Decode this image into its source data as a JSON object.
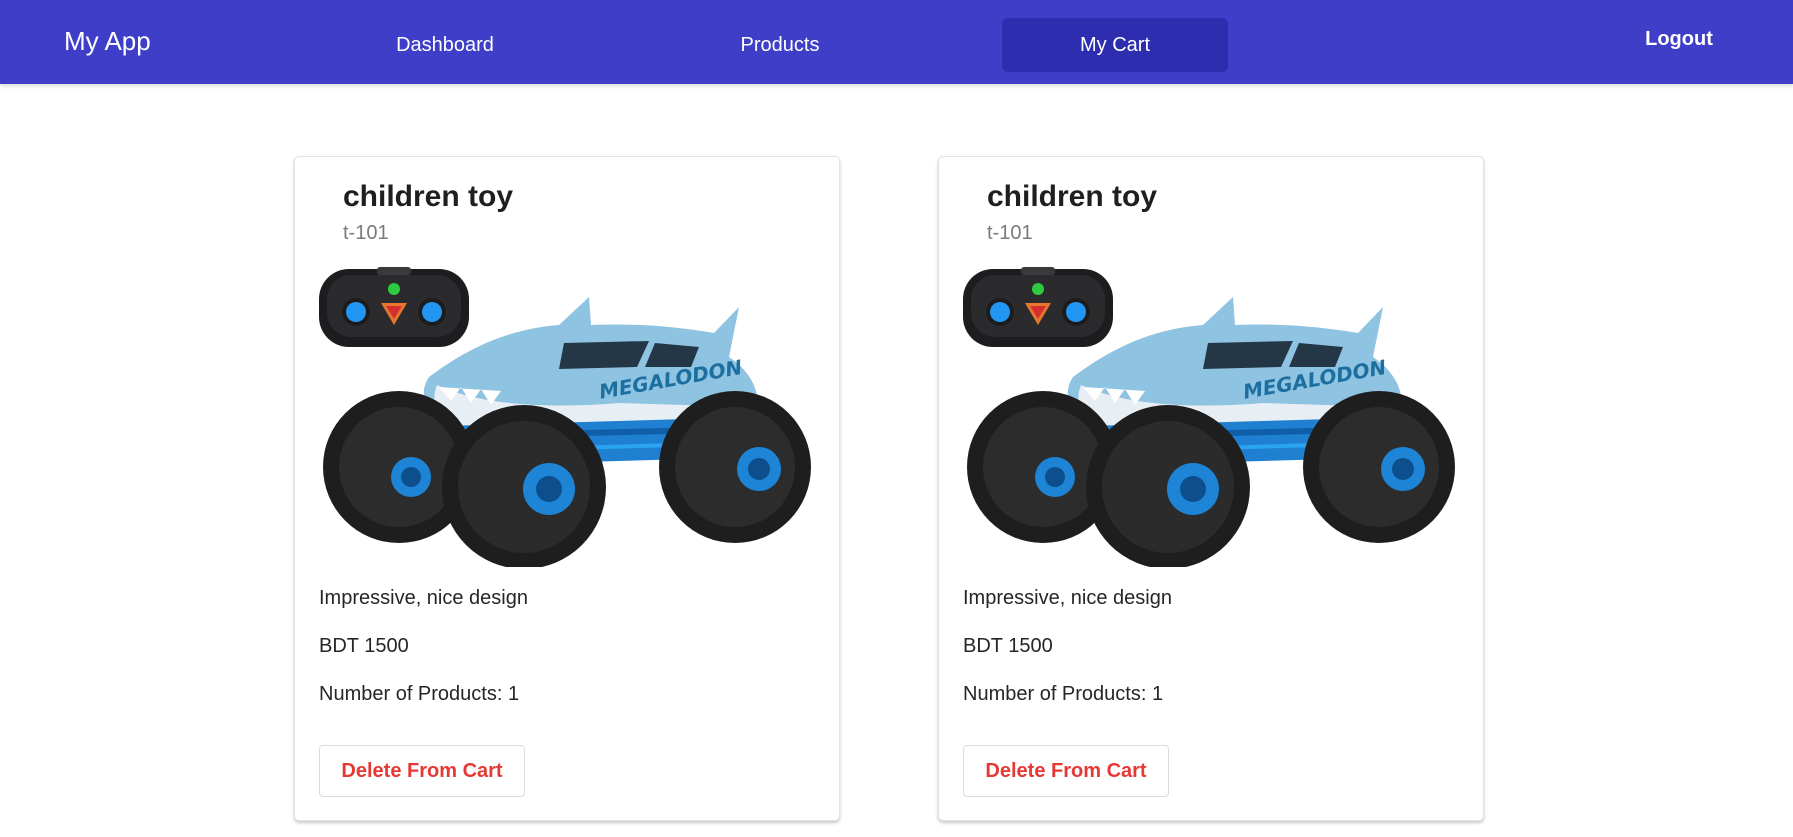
{
  "app": {
    "title": "My App"
  },
  "nav": {
    "dashboard": "Dashboard",
    "products": "Products",
    "cart": "My Cart",
    "logout": "Logout",
    "active": "My Cart"
  },
  "colors": {
    "navbar": "#3e3ec8",
    "nav_active": "#2d2daf",
    "delete_text": "#e53935"
  },
  "cart_items": [
    {
      "title": "children toy",
      "code": "t-101",
      "image": "monster-truck-toy-image",
      "description": "Impressive, nice design",
      "price": "BDT 1500",
      "quantity": "Number of Products: 1",
      "delete_label": "Delete From Cart"
    },
    {
      "title": "children toy",
      "code": "t-101",
      "image": "monster-truck-toy-image",
      "description": "Impressive, nice design",
      "price": "BDT 1500",
      "quantity": "Number of Products: 1",
      "delete_label": "Delete From Cart"
    }
  ]
}
